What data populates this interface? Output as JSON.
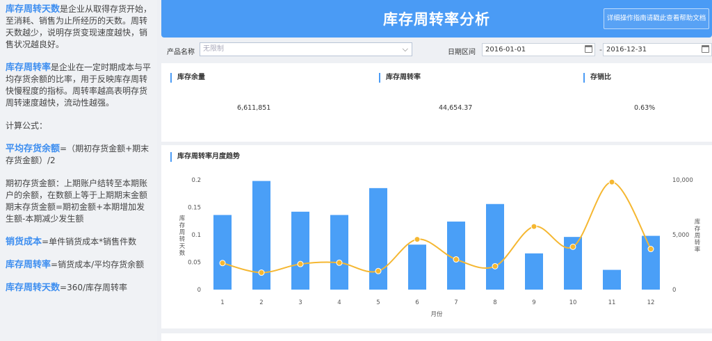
{
  "sidebar": {
    "p1_term": "库存周转天数",
    "p1_text": "是企业从取得存货开始，至消耗、销售为止所经历的天数。周转天数越少，说明存货变现速度越快，销售状况越良好。",
    "p2_term": "库存周转率",
    "p2_text": "是企业在一定时期成本与平均存货余额的比率，用于反映库存周转快慢程度的指标。周转率越高表明存货周转速度越快，流动性越强。",
    "formula_heading": "计算公式：",
    "f1_term": "平均存货余额",
    "f1_text": "=（期初存货金额+期末存货金额）/2",
    "f2_line1": "期初存货金额：上期账户结转至本期账户的余额，在数额上等于上期期末金额",
    "f2_line2": "期末存货金额=期初金额+本期增加发生额-本期减少发生额",
    "f3_term": "销货成本",
    "f3_text": "=单件销货成本*销售件数",
    "f4_term": "库存周转率",
    "f4_text": "=销货成本/平均存货余额",
    "f5_term": "库存周转天数",
    "f5_text": "=360/库存周转率"
  },
  "header": {
    "title": "库存周转率分析",
    "help_button": "详细操作指南请戳此查看帮助文档"
  },
  "filters": {
    "product_label": "产品名称",
    "product_placeholder": "无限制",
    "date_label": "日期区间",
    "date_start": "2016-01-01",
    "date_separator": "-",
    "date_end": "2016-12-31"
  },
  "kpis": [
    {
      "label": "库存余量",
      "value": "6,611,851"
    },
    {
      "label": "库存周转率",
      "value": "44,654.37"
    },
    {
      "label": "存销比",
      "value": "0.63%"
    }
  ],
  "icons": {
    "dropdown": "chevron-down-icon",
    "calendar": "calendar-icon"
  },
  "colors": {
    "accent": "#4a9bf5",
    "bar": "#4a9ff7",
    "line": "#f5b731"
  },
  "chart_data": {
    "type": "bar",
    "title": "库存周转率月度趋势",
    "xlabel": "月份",
    "ylabel": "库存周转天数",
    "y2label": "库存周转率",
    "categories": [
      "1",
      "2",
      "3",
      "4",
      "5",
      "6",
      "7",
      "8",
      "9",
      "10",
      "11",
      "12"
    ],
    "ylim": [
      0,
      0.2
    ],
    "yticks": [
      "0",
      "0.05",
      "0.1",
      "0.15",
      "0.2"
    ],
    "y2lim": [
      0,
      10000
    ],
    "y2ticks": [
      "0",
      "5,000",
      "10,000"
    ],
    "series": [
      {
        "name": "库存周转天数",
        "type": "bar",
        "axis": "left",
        "values": [
          0.136,
          0.198,
          0.142,
          0.136,
          0.185,
          0.082,
          0.124,
          0.156,
          0.066,
          0.096,
          0.036,
          0.098
        ]
      },
      {
        "name": "库存周转率",
        "type": "line",
        "axis": "right",
        "values": [
          2420,
          1550,
          2330,
          2450,
          1690,
          4580,
          2750,
          2130,
          5750,
          3900,
          9800,
          3700
        ]
      }
    ]
  }
}
